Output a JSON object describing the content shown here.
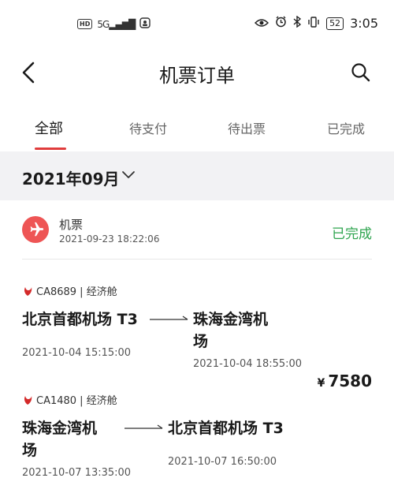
{
  "status_bar": {
    "hd": "HD",
    "network": "5G",
    "battery": "52",
    "time": "3:05"
  },
  "header": {
    "title": "机票订单"
  },
  "tabs": [
    {
      "label": "全部",
      "active": true
    },
    {
      "label": "待支付",
      "active": false
    },
    {
      "label": "待出票",
      "active": false
    },
    {
      "label": "已完成",
      "active": false
    }
  ],
  "month": {
    "label": "2021年09月"
  },
  "order": {
    "type": "机票",
    "created": "2021-09-23 18:22:06",
    "status": "已完成",
    "price_symbol": "¥",
    "price": "7580",
    "flights": [
      {
        "flight_no": "CA8689 | 经济舱",
        "from_line1": "北京首都机场 T3",
        "from_line2": "",
        "to_line1": "珠海金湾机",
        "to_line2": "场",
        "depart": "2021-10-04 15:15:00",
        "arrive": "2021-10-04 18:55:00"
      },
      {
        "flight_no": "CA1480 | 经济舱",
        "from_line1": "珠海金湾机",
        "from_line2": "场",
        "to_line1": "北京首都机场 T3",
        "to_line2": "",
        "depart": "2021-10-07 13:35:00",
        "arrive": "2021-10-07 16:50:00"
      }
    ]
  },
  "colors": {
    "accent": "#e03c3c",
    "plane_circle": "#ee5555",
    "status_done": "#2ea44f",
    "band": "#f2f2f4"
  }
}
